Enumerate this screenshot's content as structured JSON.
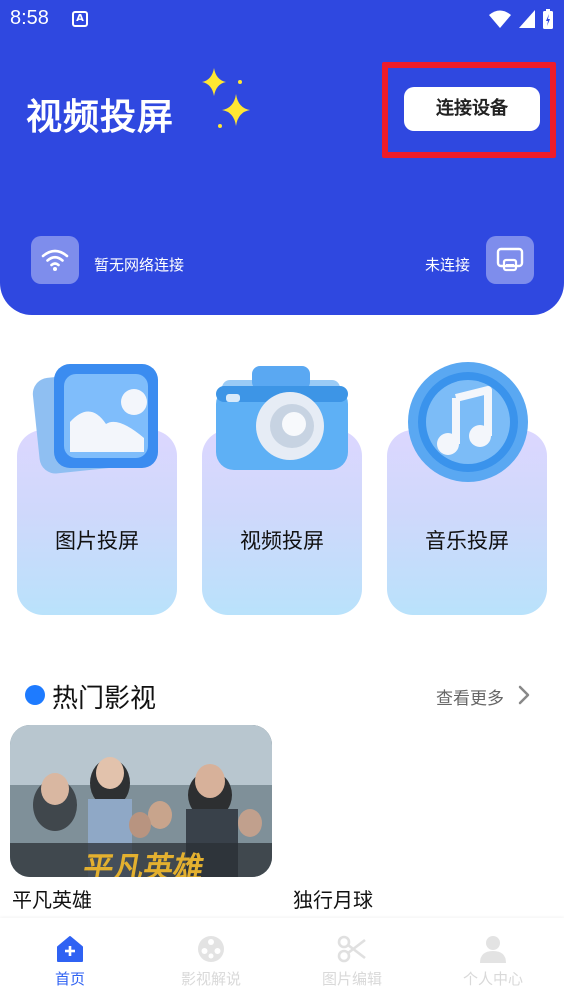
{
  "status_bar": {
    "time": "8:58",
    "badge": "A"
  },
  "header": {
    "title": "视频投屏",
    "connect_button": "连接设备",
    "network_status": "暂无网络连接",
    "connection_status": "未连接"
  },
  "features": [
    {
      "label": "图片投屏",
      "icon": "image-icon"
    },
    {
      "label": "视频投屏",
      "icon": "camera-icon"
    },
    {
      "label": "音乐投屏",
      "icon": "music-icon"
    }
  ],
  "hot_section": {
    "title": "热门影视",
    "more": "查看更多",
    "items": [
      {
        "title": "平凡英雄",
        "poster_text": "平凡英雄"
      },
      {
        "title": "独行月球"
      }
    ]
  },
  "bottom_nav": [
    {
      "label": "首页",
      "icon": "home-icon",
      "active": true
    },
    {
      "label": "影视解说",
      "icon": "film-reel-icon",
      "active": false
    },
    {
      "label": "图片编辑",
      "icon": "scissors-icon",
      "active": false
    },
    {
      "label": "个人中心",
      "icon": "person-icon",
      "active": false
    }
  ],
  "colors": {
    "primary": "#2f48e0",
    "highlight_frame": "#ee1c2a",
    "accent_dot": "#1e7bff",
    "active_nav": "#2f62f3"
  }
}
